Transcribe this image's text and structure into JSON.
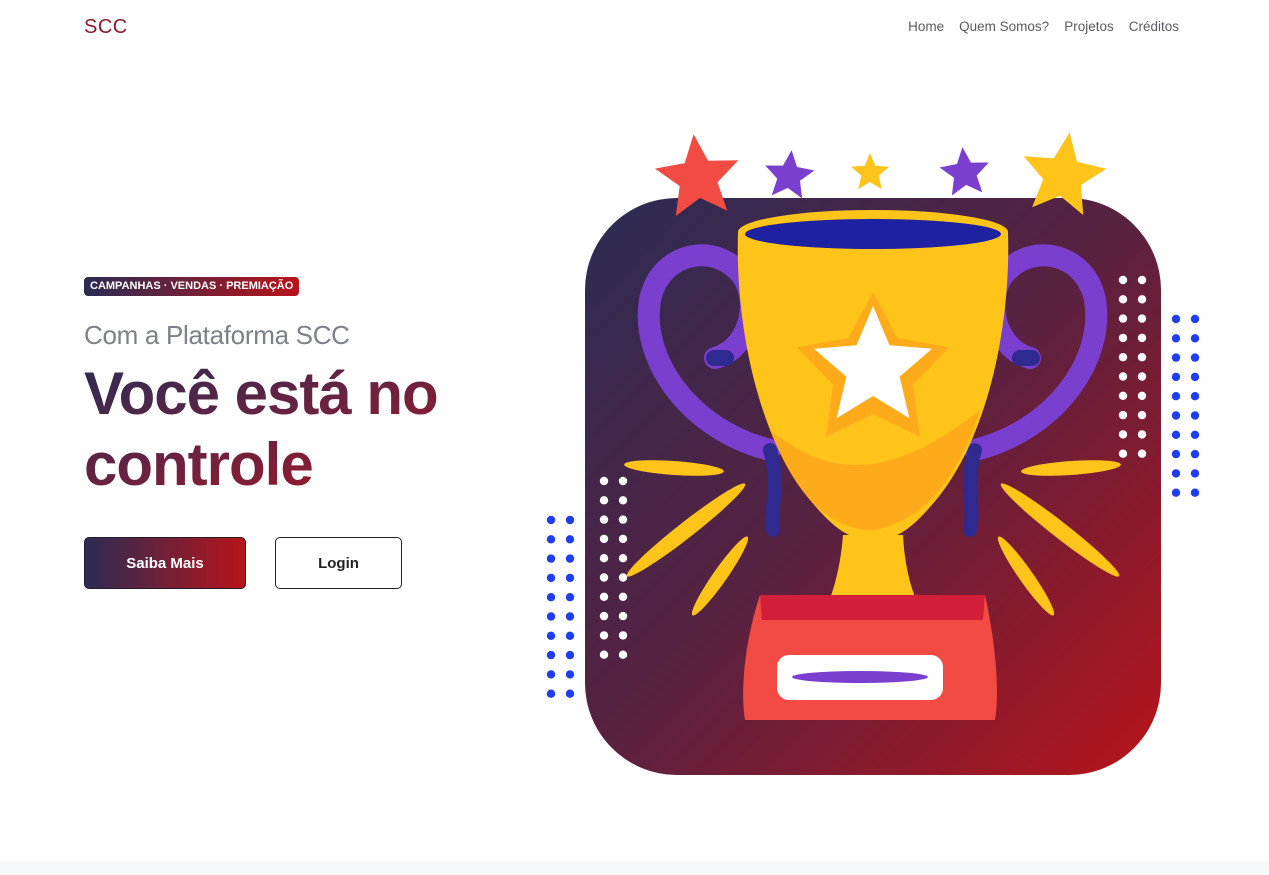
{
  "nav": {
    "brand": "SCC",
    "links": [
      "Home",
      "Quem Somos?",
      "Projetos",
      "Créditos"
    ]
  },
  "hero": {
    "badge": "CAMPANHAS · VENDAS · PREMIAÇÃO",
    "subtitle": "Com a Plataforma SCC",
    "headline_line1": "Você está no",
    "headline_line2": "controle",
    "primary_button": "Saiba Mais",
    "secondary_button": "Login"
  },
  "colors": {
    "brand": "#8b1a2b",
    "gradient_start": "#2b2c54",
    "gradient_end": "#b8141a",
    "trophy_gold": "#fec41a",
    "accent_purple": "#7b3fcf",
    "accent_red_star": "#f14b43",
    "dots_blue": "#1e3ef0"
  },
  "illustration": {
    "icons": [
      "trophy-icon",
      "star-icon"
    ]
  }
}
